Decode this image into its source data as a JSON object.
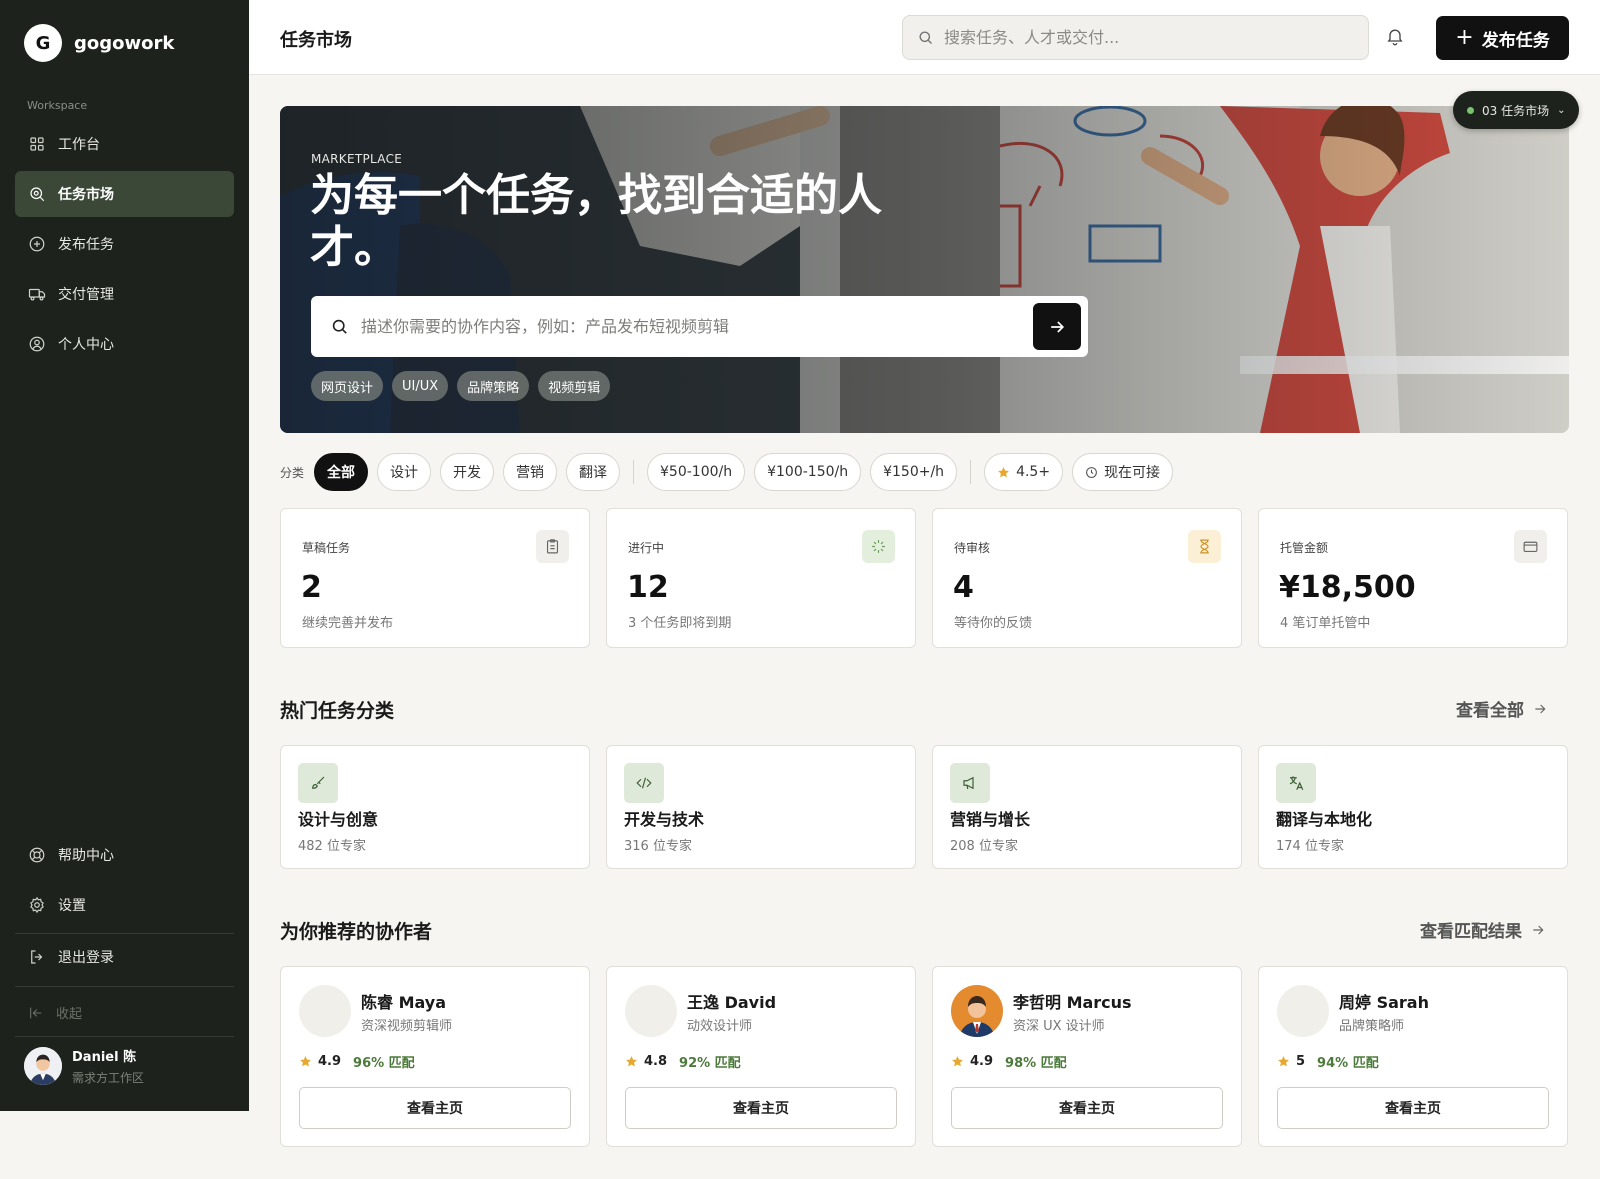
{
  "brand": {
    "logo_letter": "G",
    "name": "gogowork"
  },
  "sidebar": {
    "workspace_label": "Workspace",
    "items": [
      {
        "label": "工作台",
        "icon": "grid-icon",
        "active": false
      },
      {
        "label": "任务市场",
        "icon": "search-icon",
        "active": true
      },
      {
        "label": "发布任务",
        "icon": "plus-circle-icon",
        "active": false
      },
      {
        "label": "交付管理",
        "icon": "truck-icon",
        "active": false
      },
      {
        "label": "个人中心",
        "icon": "user-circle-icon",
        "active": false
      }
    ],
    "bottom_items": [
      {
        "label": "帮助中心",
        "icon": "lifebuoy-icon"
      },
      {
        "label": "设置",
        "icon": "gear-icon"
      },
      {
        "label": "退出登录",
        "icon": "logout-icon"
      }
    ],
    "collapse_label": "收起",
    "user": {
      "name": "Daniel 陈",
      "role": "需求方工作区"
    }
  },
  "header": {
    "title": "任务市场",
    "search_placeholder": "搜索任务、人才或交付...",
    "publish_label": "发布任务"
  },
  "hero": {
    "kicker": "MARKETPLACE",
    "title": "为每一个任务，找到合适的人才。",
    "search_placeholder": "描述你需要的协作内容，例如：产品发布短视频剪辑",
    "tags": [
      "网页设计",
      "UI/UX",
      "品牌策略",
      "视频剪辑"
    ]
  },
  "screen_pill": "03 任务市场",
  "filters": {
    "label": "分类",
    "categories": [
      "全部",
      "设计",
      "开发",
      "营销",
      "翻译"
    ],
    "active_category": "全部",
    "rates": [
      "¥50-100/h",
      "¥100-150/h",
      "¥150+/h"
    ],
    "rating": "4.5+",
    "availability": "现在可接"
  },
  "stats": [
    {
      "label": "草稿任务",
      "value": "2",
      "sub": "继续完善并发布",
      "icon": "clipboard-icon",
      "icon_bg": "#f0efeb",
      "icon_color": "#666666"
    },
    {
      "label": "进行中",
      "value": "12",
      "sub": "3 个任务即将到期",
      "icon": "loader-icon",
      "icon_bg": "#e3eedd",
      "icon_color": "#6a9a5c"
    },
    {
      "label": "待审核",
      "value": "4",
      "sub": "等待你的反馈",
      "icon": "hourglass-icon",
      "icon_bg": "#fbf0d6",
      "icon_color": "#c79328"
    },
    {
      "label": "托管金额",
      "value": "¥18,500",
      "sub": "4 笔订单托管中",
      "icon": "wallet-icon",
      "icon_bg": "#f0efeb",
      "icon_color": "#666666"
    }
  ],
  "categories_section": {
    "title": "热门任务分类",
    "link": "查看全部",
    "items": [
      {
        "name": "设计与创意",
        "count": "482 位专家",
        "icon": "brush-icon"
      },
      {
        "name": "开发与技术",
        "count": "316 位专家",
        "icon": "code-icon"
      },
      {
        "name": "营销与增长",
        "count": "208 位专家",
        "icon": "megaphone-icon"
      },
      {
        "name": "翻译与本地化",
        "count": "174 位专家",
        "icon": "translate-icon"
      }
    ]
  },
  "people_section": {
    "title": "为你推荐的协作者",
    "link": "查看匹配结果",
    "items": [
      {
        "name": "陈睿 Maya",
        "role": "资深视频剪辑师",
        "rating": "4.9",
        "match": "96% 匹配",
        "button": "查看主页",
        "has_photo": false
      },
      {
        "name": "王逸 David",
        "role": "动效设计师",
        "rating": "4.8",
        "match": "92% 匹配",
        "button": "查看主页",
        "has_photo": false
      },
      {
        "name": "李哲明 Marcus",
        "role": "资深 UX 设计师",
        "rating": "4.9",
        "match": "98% 匹配",
        "button": "查看主页",
        "has_photo": true
      },
      {
        "name": "周婷 Sarah",
        "role": "品牌策略师",
        "rating": "5",
        "match": "94% 匹配",
        "button": "查看主页",
        "has_photo": false
      }
    ]
  },
  "colors": {
    "sidebar_bg": "#1e221d",
    "active_nav": "#3b4737",
    "accent_green": "#4c7a3b",
    "star": "#e7a830"
  }
}
